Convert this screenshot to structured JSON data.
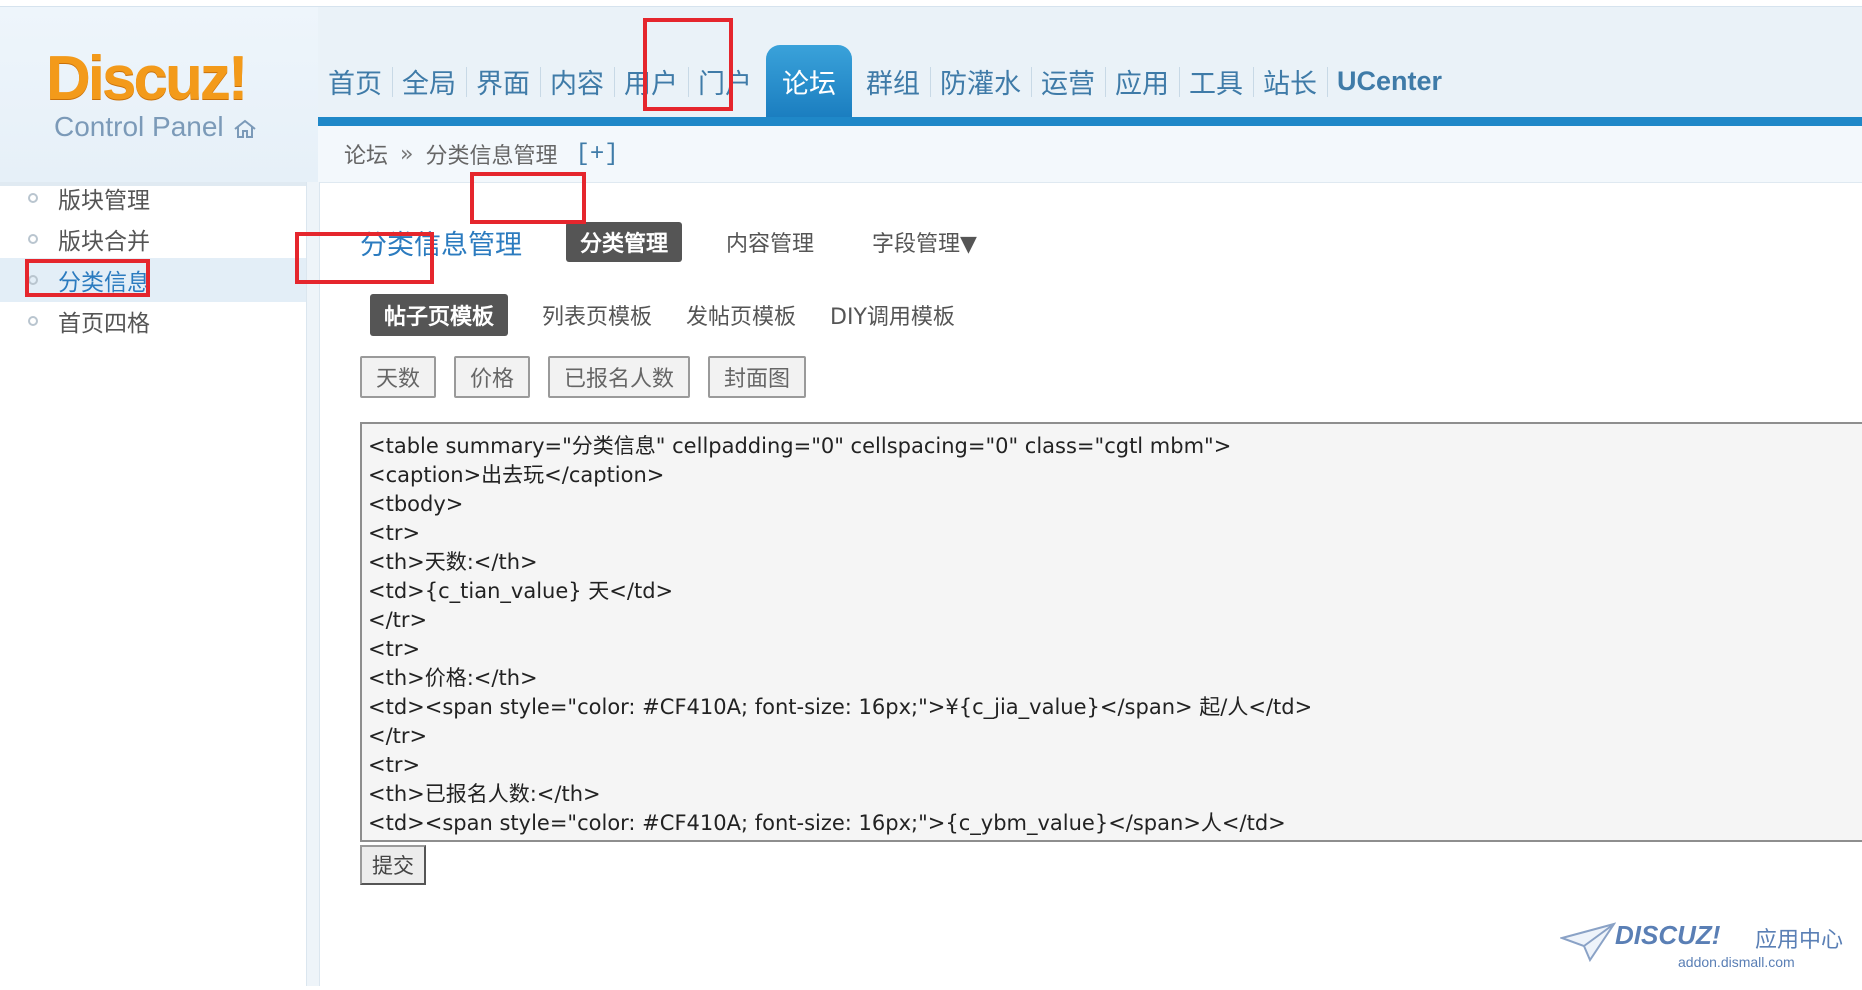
{
  "logo": {
    "main": "Discuz!",
    "sub": "Control Panel"
  },
  "nav": {
    "items": [
      "首页",
      "全局",
      "界面",
      "内容",
      "用户",
      "门户",
      "论坛",
      "群组",
      "防灌水",
      "运营",
      "应用",
      "工具",
      "站长",
      "UCenter"
    ],
    "active": "论坛"
  },
  "breadcrumb": {
    "root": "论坛",
    "separator": "»",
    "current": "分类信息管理",
    "expand": "[+]"
  },
  "sidebar": {
    "items": [
      "版块管理",
      "版块合并",
      "分类信息",
      "首页四格"
    ],
    "active": "分类信息"
  },
  "main": {
    "title": "分类信息管理",
    "tabs": [
      "分类管理",
      "内容管理",
      "字段管理▼"
    ],
    "subtabs": [
      "帖子页模板",
      "列表页模板",
      "发帖页模板",
      "DIY调用模板"
    ],
    "variables": [
      "天数",
      "价格",
      "已报名人数",
      "封面图"
    ],
    "template_code": "<table summary=\"分类信息\" cellpadding=\"0\" cellspacing=\"0\" class=\"cgtl mbm\">\n<caption>出去玩</caption>\n<tbody>\n<tr>\n<th>天数:</th>\n<td>{c_tian_value} 天</td>\n</tr>\n<tr>\n<th>价格:</th>\n<td><span style=\"color: #CF410A; font-size: 16px;\">¥{c_jia_value}</span> 起/人</td>\n</tr>\n<tr>\n<th>已报名人数:</th>\n<td><span style=\"color: #CF410A; font-size: 16px;\">{c_ybm_value}</span>人</td>\n</tr>",
    "submit_label": "提交"
  },
  "watermark": {
    "brand": "DISCUZ!",
    "brand_cn": "应用中心",
    "url": "addon.dismall.com"
  },
  "colors": {
    "highlight": "#e5262d",
    "nav_active": "#1f88c8",
    "accent_text": "#2b7bbf"
  }
}
